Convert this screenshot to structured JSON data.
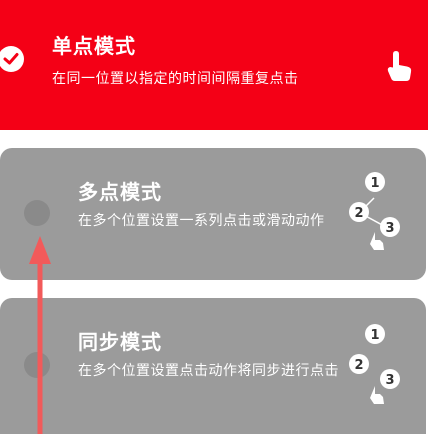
{
  "modes": [
    {
      "title": "单点模式",
      "description": "在同一位置以指定的时间间隔重复点击",
      "selected": true
    },
    {
      "title": "多点模式",
      "description": "在多个位置设置一系列点击或滑动动作",
      "selected": false,
      "markers": [
        "1",
        "2",
        "3"
      ]
    },
    {
      "title": "同步模式",
      "description": "在多个位置设置点击动作将同步进行点击",
      "selected": false,
      "markers": [
        "1",
        "2",
        "3"
      ]
    }
  ],
  "colors": {
    "selected_bg": "#f40016",
    "card_bg": "#9b9b9b",
    "radio": "#8a8a8a",
    "arrow": "#f25a5a"
  },
  "icons": {
    "selected_check": "check-icon",
    "single_tap": "single-tap-hand-icon",
    "multi_tap": "multi-tap-hand-icon"
  }
}
